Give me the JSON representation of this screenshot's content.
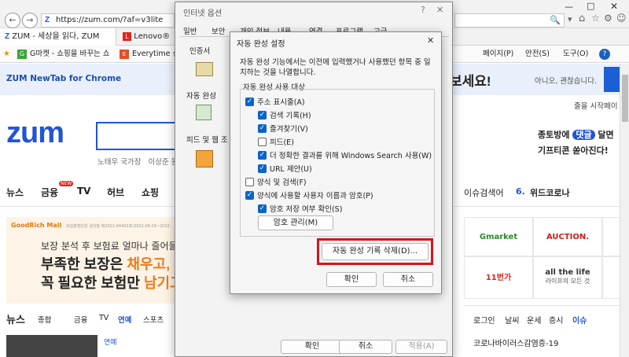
{
  "browser": {
    "address": "https://zum.com/?af=v3lite",
    "tabs": [
      {
        "label": "ZUM - 세상을 읽다, ZUM"
      },
      {
        "label": "Lenovo® 한"
      }
    ],
    "favorites": [
      {
        "label": "G마켓 - 쇼핑을 바꾸는 쇼"
      },
      {
        "label": "Everytime 십"
      }
    ],
    "toolbar": {
      "page": "페이지(P)",
      "safety": "안전(S)",
      "tools": "도구(O)"
    }
  },
  "page": {
    "newtab": "ZUM NewTab for Chrome",
    "banner_cta": "보세요!",
    "banner_dismiss": "아니오, 괜찮습니다.",
    "banner_side": "줄을 시작페이",
    "logo": "zum",
    "search_hint": "노태우 국가장   이상준 원",
    "menu": [
      "뉴스",
      "금융",
      "TV",
      "허브",
      "쇼핑"
    ],
    "menu_new": "NEW",
    "trending": "이슈검색어",
    "trending_rank": "6.",
    "trending_term": "위드코로나",
    "promo": {
      "line1": "종토방에",
      "highlight": "댓글",
      "line1_end": "달면",
      "line2": "기프티콘 쏟아진다!"
    },
    "ad": {
      "brand": "GoodRich Mall",
      "fine": "보험분쟁민원 심의필 제2021-04402호(2021.09.29~2022.",
      "headline": "보장 분석 후 보험료 얼마나 줄어들",
      "line1a": "부족한 보장은",
      "line1b": "채우고,",
      "line2a": "꼭 필요한 보험만",
      "line2b": "남기고"
    },
    "news_title": "뉴스",
    "news_tabs": [
      "종합",
      "금융",
      "TV",
      "연예",
      "스포츠"
    ],
    "news_item": "연예",
    "shops": [
      {
        "name": "Gmarket"
      },
      {
        "name": "AUCTION."
      },
      {
        "name": "11번가"
      },
      {
        "name": "all the life"
      }
    ],
    "shop_sub": "라이프의 모든 것",
    "login_links": [
      "로그인",
      "날씨",
      "운세",
      "증시",
      "이슈"
    ],
    "issue_item": "코로나바이러스감염증-19"
  },
  "internet_options": {
    "title": "인터넷 옵션",
    "tabs": [
      "일반",
      "보안",
      "개인 정보",
      "내용",
      "연결",
      "프로그램",
      "고급"
    ],
    "sections": [
      "인증서",
      "자동 완성",
      "피드 및 웹 조"
    ],
    "ok": "확인",
    "cancel": "취소",
    "apply": "적용(A)"
  },
  "autocomplete": {
    "title": "자동 완성 설정",
    "description": "자동 완성 기능에서는 이전에 입력했거나 사용했던 항목 중 일치하는 것을 나열합니다.",
    "group_label": "자동 완성 사용 대상",
    "options": [
      {
        "label": "주소 표시줄(A)",
        "checked": true,
        "indent": 0
      },
      {
        "label": "검색 기록(H)",
        "checked": true,
        "indent": 1
      },
      {
        "label": "즐겨찾기(V)",
        "checked": true,
        "indent": 1
      },
      {
        "label": "피드(E)",
        "checked": false,
        "indent": 1
      },
      {
        "label": "더 정확한 결과를 위해 Windows Search 사용(W)",
        "checked": true,
        "indent": 1
      },
      {
        "label": "URL 제안(U)",
        "checked": true,
        "indent": 1
      },
      {
        "label": "양식 및 검색(F)",
        "checked": false,
        "indent": 0
      },
      {
        "label": "양식에 사용할 사용자 이름과 암호(P)",
        "checked": true,
        "indent": 0
      },
      {
        "label": "암호 저장 여부 확인(S)",
        "checked": true,
        "indent": 1
      }
    ],
    "manage_passwords": "암호 관리(M)",
    "delete_history": "자동 완성 기록 삭제(D)...",
    "ok": "확인",
    "cancel": "취소",
    "highlight_color": "#d9121b"
  }
}
